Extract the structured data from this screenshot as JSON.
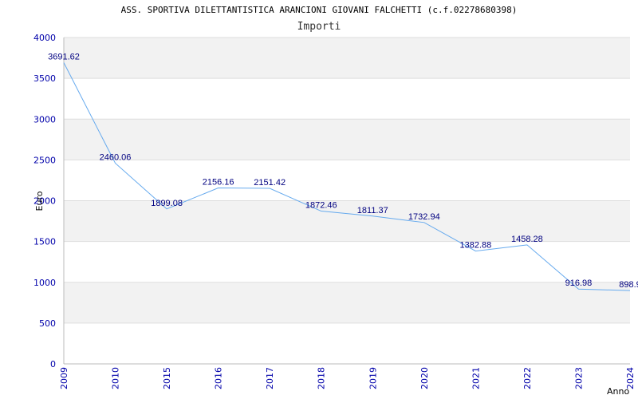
{
  "header": {
    "title": "ASS. SPORTIVA DILETTANTISTICA ARANCIONI GIOVANI FALCHETTI (c.f.02278680398)",
    "subtitle": "Importi"
  },
  "chart_data": {
    "type": "line",
    "title": "ASS. SPORTIVA DILETTANTISTICA ARANCIONI GIOVANI FALCHETTI (c.f.02278680398)",
    "subtitle": "Importi",
    "xlabel": "Anno",
    "ylabel": "Euro",
    "ylim": [
      0,
      4000
    ],
    "yticks": [
      0,
      500,
      1000,
      1500,
      2000,
      2500,
      3000,
      3500,
      4000
    ],
    "categories": [
      "2009",
      "2010",
      "2015",
      "2016",
      "2017",
      "2018",
      "2019",
      "2020",
      "2021",
      "2022",
      "2023",
      "2024"
    ],
    "series": [
      {
        "values": [
          3691.62,
          2460.06,
          1899.08,
          2156.16,
          2151.42,
          1872.46,
          1811.37,
          1732.94,
          1382.88,
          1458.28,
          916.98,
          898.9
        ],
        "labels": [
          "3691.62",
          "2460.06",
          "1899.08",
          "2156.16",
          "2151.42",
          "1872.46",
          "1811.37",
          "1732.94",
          "1382.88",
          "1458.28",
          "916.98",
          "898.9"
        ]
      }
    ],
    "grid": true,
    "colors": {
      "line": "#66aaee",
      "band": "#f2f2f2",
      "gridline": "#dddddd",
      "tick_text": "#0000aa",
      "label_text": "#000080"
    }
  }
}
